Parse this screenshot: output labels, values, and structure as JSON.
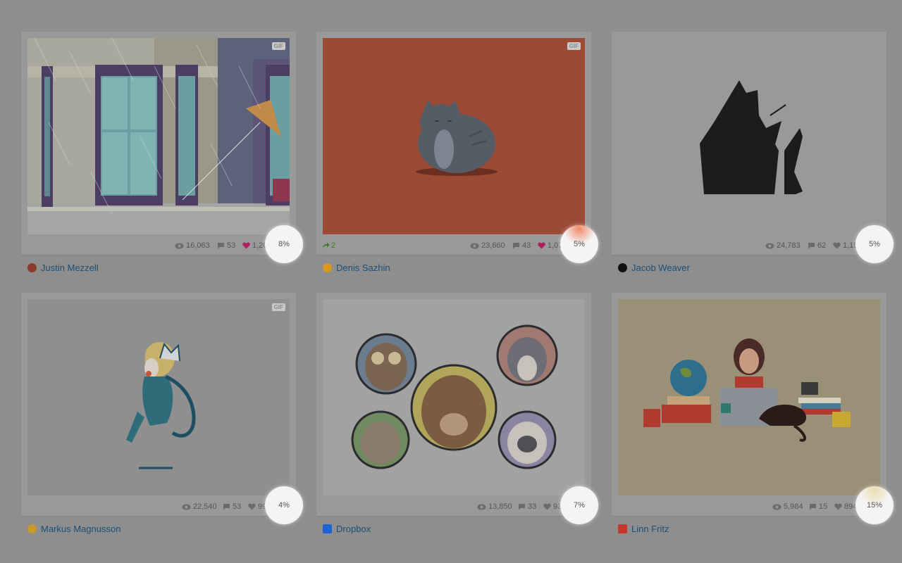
{
  "cards": [
    {
      "gif": "GIF",
      "views": "16,063",
      "comments": "53",
      "likes": "1,206",
      "percent": "8%",
      "rebounds": "",
      "author": "Justin Mezzell",
      "liked": true,
      "avatar_color": "#8a3b2c"
    },
    {
      "gif": "GIF",
      "views": "23,660",
      "comments": "43",
      "likes": "1,075",
      "percent": "5%",
      "rebounds": "2",
      "author": "Denis Sazhin",
      "liked": true,
      "avatar_color": "#d79a1e"
    },
    {
      "gif": "",
      "views": "24,783",
      "comments": "62",
      "likes": "1,151",
      "percent": "5%",
      "rebounds": "",
      "author": "Jacob Weaver",
      "liked": false,
      "avatar_color": "#111111"
    },
    {
      "gif": "GIF",
      "views": "22,540",
      "comments": "53",
      "likes": "996",
      "percent": "4%",
      "rebounds": "",
      "author": "Markus Magnusson",
      "liked": false,
      "avatar_color": "#c79a2a"
    },
    {
      "gif": "",
      "views": "13,850",
      "comments": "33",
      "likes": "936",
      "percent": "7%",
      "rebounds": "",
      "author": "Dropbox",
      "liked": false,
      "avatar_color": "#1d62d8"
    },
    {
      "gif": "",
      "views": "5,984",
      "comments": "15",
      "likes": "894",
      "percent": "15%",
      "rebounds": "",
      "author": "Linn Fritz",
      "liked": false,
      "avatar_color": "#c5362b"
    }
  ],
  "colors": {
    "overlay_bg": "#8e8e8e",
    "link": "#1c4f74",
    "like_active": "#b0205f",
    "rebound": "#3d7a2c",
    "highlight": "#f4f4f4"
  },
  "icons": {
    "views": "eye-icon",
    "comments": "speech-bubble-icon",
    "likes": "heart-icon",
    "rebound": "rebound-arrow-icon"
  }
}
